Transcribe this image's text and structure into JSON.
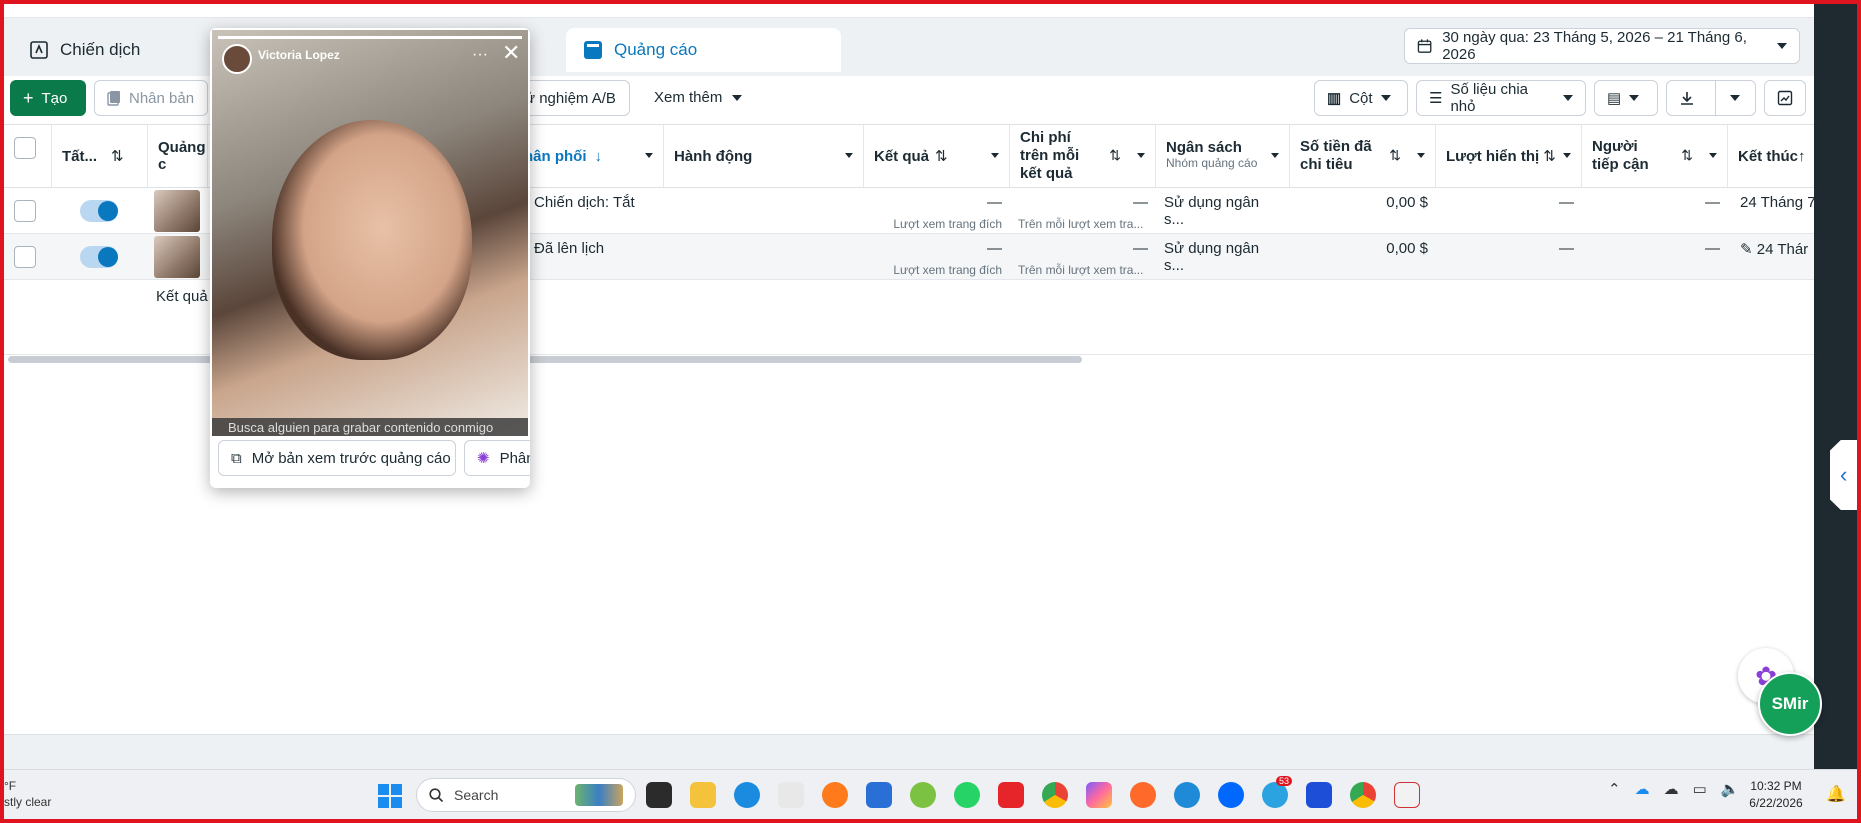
{
  "tabs": {
    "campaigns": "Chiến dịch",
    "ads": "Quảng cáo"
  },
  "date_range": "30 ngày qua: 23 Tháng 5, 2026 – 21 Tháng 6, 2026",
  "toolbar": {
    "create": "Tạo",
    "duplicate": "Nhân bản",
    "ab_test": "ử nghiệm A/B",
    "see_more": "Xem thêm",
    "columns": "Cột",
    "breakdown": "Số liệu chia nhỏ"
  },
  "columns": {
    "status": "Tất...",
    "ad": "Quảng c",
    "delivery": "hân phối",
    "actions": "Hành động",
    "results": "Kết quả",
    "cost_per_result": "Chi phí trên mỗi kết quả",
    "budget": "Ngân sách",
    "budget_sub": "Nhóm quảng cáo",
    "amount_spent": "Số tiền đã chi tiêu",
    "impressions": "Lượt hiển thị",
    "reach": "Người tiếp cận",
    "ends": "Kết thúc"
  },
  "rows": [
    {
      "delivery": "Chiến dịch: Tắt",
      "results": "—",
      "results_sub": "Lượt xem trang đích",
      "cost": "—",
      "cost_sub": "Trên mỗi lượt xem tra...",
      "budget": "Sử dụng ngân s...",
      "spent": "0,00 $",
      "impressions": "—",
      "reach": "—",
      "ends": "24 Tháng 7"
    },
    {
      "delivery": "Đã lên lịch",
      "results": "—",
      "results_sub": "Lượt xem trang đích",
      "cost": "—",
      "cost_sub": "Trên mỗi lượt xem tra...",
      "budget": "Sử dụng ngân s...",
      "spent": "0,00 $",
      "impressions": "—",
      "reach": "—",
      "ends": "24 Thár"
    }
  ],
  "results_label": "Kết quả",
  "preview": {
    "username": "Victoria Lopez",
    "caption": "Busca alguien para grabar contenido conmigo",
    "open_preview": "Mở bản xem trước quảng cáo",
    "second_button": "Phân"
  },
  "fab_label": "SMir",
  "taskbar": {
    "weather_unit": "°F",
    "weather_text": "stly clear",
    "search_placeholder": "Search",
    "time": "10:32 PM",
    "date": "6/22/2026",
    "badge": "53"
  },
  "colors": {
    "accent": "#0a78be",
    "create": "#0b7a4b",
    "frame": "#e0141e"
  }
}
